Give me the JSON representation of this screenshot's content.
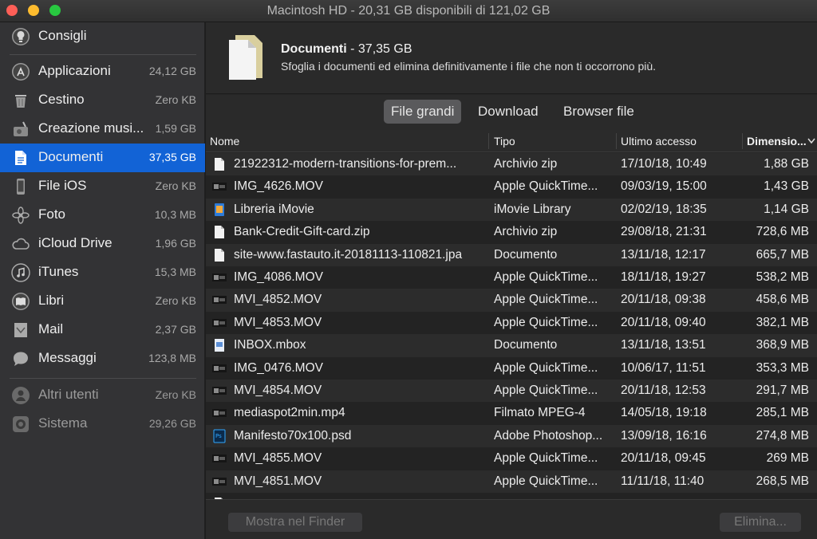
{
  "window": {
    "title": "Macintosh HD - 20,31 GB disponibili di 121,02 GB"
  },
  "sidebar": {
    "items": [
      {
        "label": "Consigli",
        "size": ""
      },
      {
        "label": "Applicazioni",
        "size": "24,12 GB"
      },
      {
        "label": "Cestino",
        "size": "Zero KB"
      },
      {
        "label": "Creazione musi...",
        "size": "1,59 GB"
      },
      {
        "label": "Documenti",
        "size": "37,35 GB"
      },
      {
        "label": "File iOS",
        "size": "Zero KB"
      },
      {
        "label": "Foto",
        "size": "10,3 MB"
      },
      {
        "label": "iCloud Drive",
        "size": "1,96 GB"
      },
      {
        "label": "iTunes",
        "size": "15,3 MB"
      },
      {
        "label": "Libri",
        "size": "Zero KB"
      },
      {
        "label": "Mail",
        "size": "2,37 GB"
      },
      {
        "label": "Messaggi",
        "size": "123,8 MB"
      },
      {
        "label": "Altri utenti",
        "size": "Zero KB"
      },
      {
        "label": "Sistema",
        "size": "29,26 GB"
      }
    ]
  },
  "header": {
    "title": "Documenti",
    "title_size": " - 37,35 GB",
    "description": "Sfoglia i documenti ed elimina definitivamente i file che non ti occorrono più."
  },
  "tabs": [
    {
      "label": "File grandi"
    },
    {
      "label": "Download"
    },
    {
      "label": "Browser file"
    }
  ],
  "table": {
    "columns": {
      "name": "Nome",
      "type": "Tipo",
      "date": "Ultimo accesso",
      "size": "Dimensio..."
    },
    "rows": [
      {
        "name": "21922312-modern-transitions-for-prem...",
        "type": "Archivio zip",
        "date": "17/10/18, 10:49",
        "size": "1,88 GB",
        "icon": "document-icon"
      },
      {
        "name": "IMG_4626.MOV",
        "type": "Apple QuickTime...",
        "date": "09/03/19, 15:00",
        "size": "1,43 GB",
        "icon": "video-thumbnail-icon"
      },
      {
        "name": "Libreria iMovie",
        "type": "iMovie Library",
        "date": "02/02/19, 18:35",
        "size": "1,14 GB",
        "icon": "imovie-library-icon"
      },
      {
        "name": "Bank-Credit-Gift-card.zip",
        "type": "Archivio zip",
        "date": "29/08/18, 21:31",
        "size": "728,6 MB",
        "icon": "document-icon"
      },
      {
        "name": "site-www.fastauto.it-20181113-110821.jpa",
        "type": "Documento",
        "date": "13/11/18, 12:17",
        "size": "665,7 MB",
        "icon": "document-icon"
      },
      {
        "name": "IMG_4086.MOV",
        "type": "Apple QuickTime...",
        "date": "18/11/18, 19:27",
        "size": "538,2 MB",
        "icon": "video-thumbnail-icon"
      },
      {
        "name": "MVI_4852.MOV",
        "type": "Apple QuickTime...",
        "date": "20/11/18, 09:38",
        "size": "458,6 MB",
        "icon": "video-thumbnail-icon"
      },
      {
        "name": "MVI_4853.MOV",
        "type": "Apple QuickTime...",
        "date": "20/11/18, 09:40",
        "size": "382,1 MB",
        "icon": "video-thumbnail-icon"
      },
      {
        "name": "INBOX.mbox",
        "type": "Documento",
        "date": "13/11/18, 13:51",
        "size": "368,9 MB",
        "icon": "mbox-icon"
      },
      {
        "name": "IMG_0476.MOV",
        "type": "Apple QuickTime...",
        "date": "10/06/17, 11:51",
        "size": "353,3 MB",
        "icon": "video-thumbnail-icon"
      },
      {
        "name": "MVI_4854.MOV",
        "type": "Apple QuickTime...",
        "date": "20/11/18, 12:53",
        "size": "291,7 MB",
        "icon": "video-thumbnail-icon"
      },
      {
        "name": "mediaspot2min.mp4",
        "type": "Filmato MPEG-4",
        "date": "14/05/18, 19:18",
        "size": "285,1 MB",
        "icon": "video-thumbnail-icon"
      },
      {
        "name": "Manifesto70x100.psd",
        "type": "Adobe Photoshop...",
        "date": "13/09/18, 16:16",
        "size": "274,8 MB",
        "icon": "photoshop-file-icon"
      },
      {
        "name": "MVI_4855.MOV",
        "type": "Apple QuickTime...",
        "date": "20/11/18, 09:45",
        "size": "269 MB",
        "icon": "video-thumbnail-icon"
      },
      {
        "name": "MVI_4851.MOV",
        "type": "Apple QuickTime...",
        "date": "11/11/18, 11:40",
        "size": "268,5 MB",
        "icon": "video-thumbnail-icon"
      },
      {
        "name": "",
        "type": "",
        "date": "",
        "size": "",
        "icon": "document-icon"
      }
    ]
  },
  "footer": {
    "finder_button": "Mostra nel Finder",
    "delete_button": "Elimina..."
  },
  "colors": {
    "selection": "#1263d6",
    "sidebar_bg": "#333335",
    "main_bg": "#262626"
  }
}
